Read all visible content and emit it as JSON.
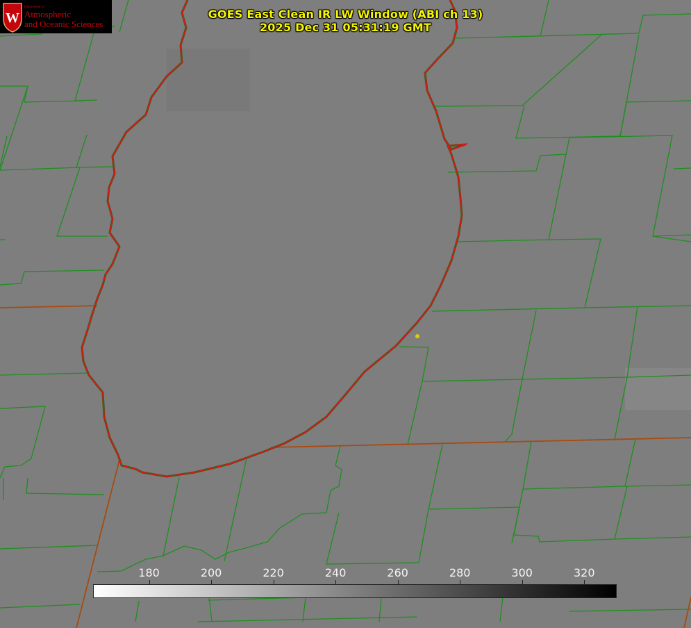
{
  "title": {
    "line1": "GOES East Clean IR LW Window (ABI ch 13)",
    "line2": "2025 Dec 31 05:31:19 GMT"
  },
  "logo": {
    "department": "Department of",
    "line1": "Atmospheric",
    "line2": "and Oceanic Sciences",
    "shield_letter": "W"
  },
  "colorbar": {
    "min_value": 162,
    "max_value": 330,
    "ticks": [
      "180",
      "200",
      "220",
      "240",
      "260",
      "280",
      "300",
      "320"
    ],
    "tick_values": [
      180,
      200,
      220,
      240,
      260,
      280,
      300,
      320
    ],
    "gradient_from": "#ffffff",
    "gradient_to": "#000000"
  },
  "colors": {
    "title_text": "#f4f400",
    "county_lines": "#1e8f1e",
    "state_lines": "#a84a10",
    "shoreline": "#e31414",
    "marker": "#d8d000",
    "background": "#7d7d7d"
  }
}
